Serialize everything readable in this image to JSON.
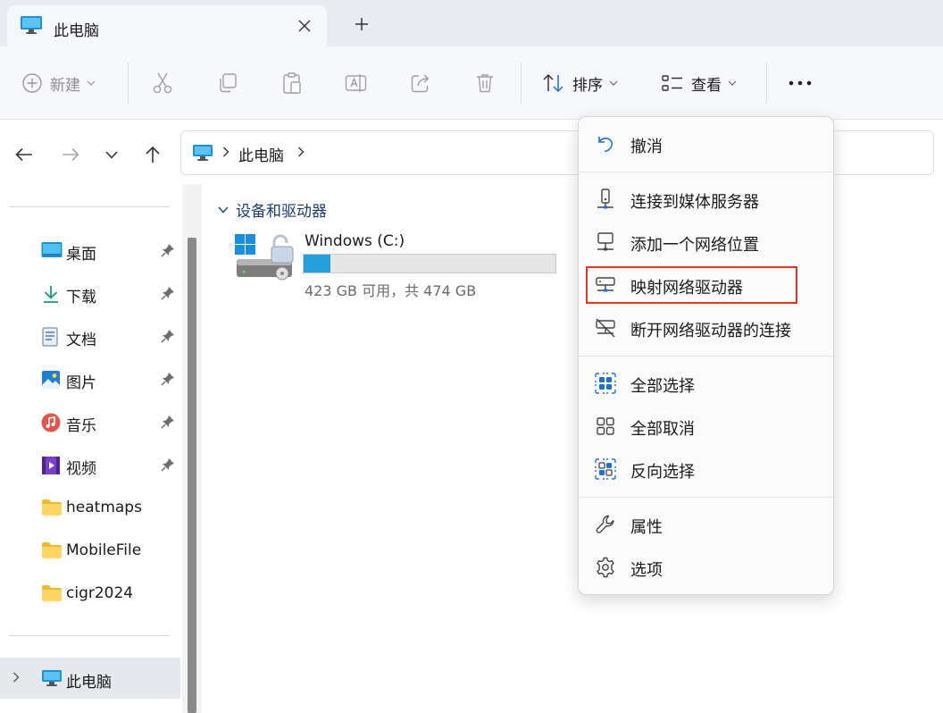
{
  "tab": {
    "title": "此电脑"
  },
  "toolbar": {
    "new_label": "新建",
    "sort_label": "排序",
    "view_label": "查看"
  },
  "address": {
    "location": "此电脑"
  },
  "sidebar": {
    "quick_access": [
      {
        "label": "桌面",
        "icon": "desktop-icon"
      },
      {
        "label": "下载",
        "icon": "download-icon"
      },
      {
        "label": "文档",
        "icon": "document-icon"
      },
      {
        "label": "图片",
        "icon": "pictures-icon"
      },
      {
        "label": "音乐",
        "icon": "music-icon"
      },
      {
        "label": "视频",
        "icon": "video-icon"
      },
      {
        "label": "heatmaps",
        "icon": "folder-icon"
      },
      {
        "label": "MobileFile",
        "icon": "folder-icon"
      },
      {
        "label": "cigr2024",
        "icon": "folder-icon"
      }
    ],
    "this_pc": {
      "label": "此电脑"
    }
  },
  "content": {
    "group_label": "设备和驱动器",
    "drive": {
      "name": "Windows (C:)",
      "free_text": "423 GB 可用，共 474 GB",
      "used_fraction": 0.108
    }
  },
  "menu": {
    "undo": "撤消",
    "connect_media_server": "连接到媒体服务器",
    "add_network_location": "添加一个网络位置",
    "map_network_drive": "映射网络驱动器",
    "disconnect_network_drive": "断开网络驱动器的连接",
    "select_all": "全部选择",
    "select_none": "全部取消",
    "invert_selection": "反向选择",
    "properties": "属性",
    "options": "选项"
  },
  "colors": {
    "accent": "#26a0da",
    "highlight_box": "#e0341f",
    "group_header": "#1c3b6e"
  }
}
